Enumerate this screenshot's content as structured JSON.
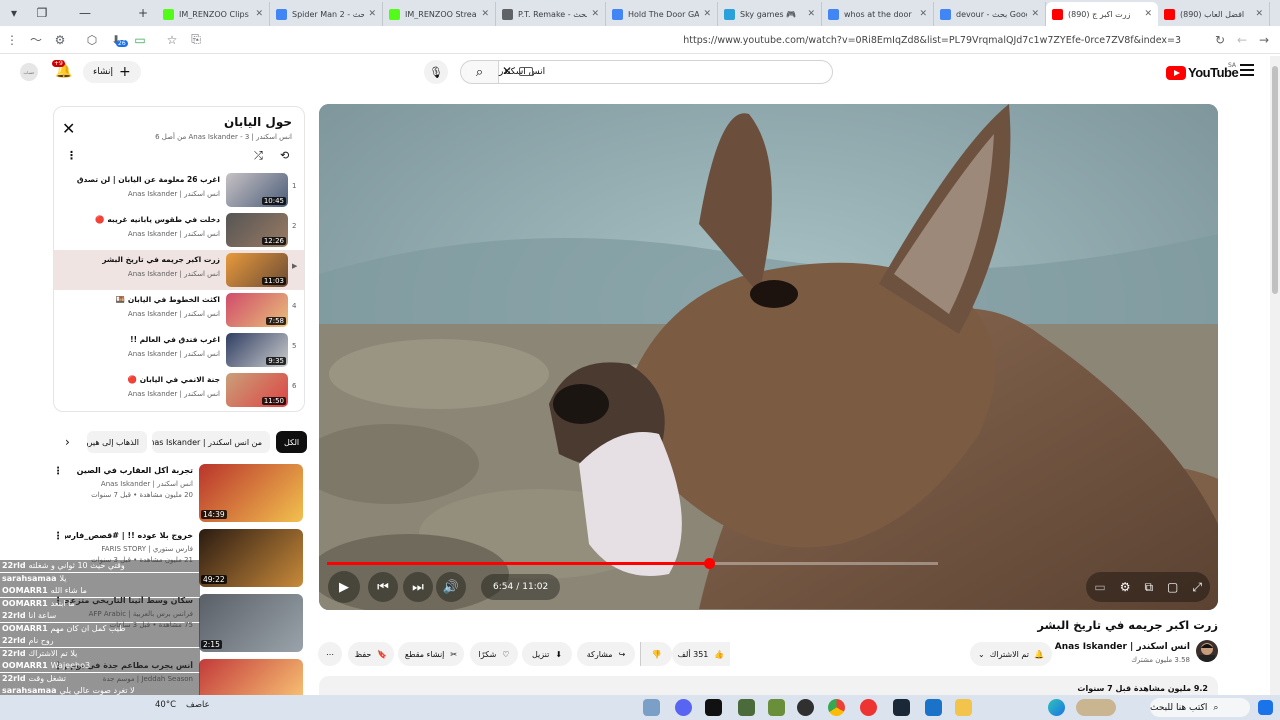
{
  "browser": {
    "tabs": [
      {
        "label": "IM_RENZOO Clips",
        "icon": "kick-icon",
        "color": "#53fc18"
      },
      {
        "label": "Spider Man 2 - بحث",
        "icon": "google-icon",
        "color": "#4285f4"
      },
      {
        "label": "IM_RENZOO Stream",
        "icon": "kick-icon",
        "color": "#53fc18"
      },
      {
        "label": "P.T. Remake - بحث",
        "icon": "globe-icon",
        "color": "#5f6368"
      },
      {
        "label": "Hold The Door GAM",
        "icon": "google-icon",
        "color": "#4285f4"
      },
      {
        "label": "Sky games 🎮",
        "icon": "telegram-icon",
        "color": "#2aa1da"
      },
      {
        "label": "whos at the door",
        "icon": "google-icon",
        "color": "#4285f4"
      },
      {
        "label": "devour - بحث Goog",
        "icon": "google-icon",
        "color": "#4285f4"
      },
      {
        "label": "(890) زرت اكبر ج",
        "icon": "youtube-icon",
        "color": "#ff0000",
        "active": true
      },
      {
        "label": "(890) افضل العاب",
        "icon": "youtube-icon",
        "color": "#ff0000"
      }
    ],
    "url": "https://www.youtube.com/watch?v=0Ri8EmIqZd8&list=PL79VrqmalQJd7c1w7ZYEfe-0rce7ZV8f&index=3",
    "downloads_badge": "26"
  },
  "masthead": {
    "logo_text": "YouTube",
    "region": "SA",
    "search_query": "انس اسكندر",
    "create_label": "إنشاء",
    "notif_count": "+9",
    "avatar_text": "حساب"
  },
  "player": {
    "current_time": "6:54",
    "duration": "11:02",
    "progress": 0.626,
    "scene_colors": {
      "sky": "#9fb9bd",
      "mountain": "#7f9ea3",
      "wall": "#8a8575",
      "deer": "#7a5a42"
    }
  },
  "video": {
    "title": "زرت اكبر جريمه في تاريخ البشر",
    "channel": "انس اسكندر | Anas Iskander",
    "subscribers": "3.58 مليون مشترك",
    "subscribed_label": "تم الاشتراك",
    "likes": "351 ألف",
    "share_label": "مشاركة",
    "download_label": "تنزيل",
    "thanks_label": "شكرًا",
    "clip_label": "إنشاء مقطع",
    "save_label": "حفظ",
    "views_line": "9.2 مليون مشاهدة  قبل 7 سنوات"
  },
  "playlist": {
    "title": "حول اليابان",
    "subtitle": "انس اسكندر | Anas Iskander - 3 من أصل 6",
    "items": [
      {
        "num": "1",
        "title": "اغرب 26 معلومة عن اليابان | لن تصدق",
        "channel": "انس اسكندر | Anas Iskander",
        "duration": "10:45"
      },
      {
        "num": "2",
        "title": "دخلت في طقوس يابانيه غريبه 🔴",
        "channel": "انس اسكندر | Anas Iskander",
        "duration": "12:26"
      },
      {
        "num": "▶",
        "title": "زرت اكبر جريمه في تاريخ البشر",
        "channel": "انس اسكندر | Anas Iskander",
        "duration": "11:03"
      },
      {
        "num": "4",
        "title": "اكثث الخطوط في اليابان 🍱",
        "channel": "انس اسكندر | Anas Iskander",
        "duration": "7:58"
      },
      {
        "num": "5",
        "title": "اغرب فندق في العالم !!",
        "channel": "انس اسكندر | Anas Iskander",
        "duration": "9:35"
      },
      {
        "num": "6",
        "title": "جنة الانمي في اليابان 🔴",
        "channel": "انس اسكندر | Anas Iskander",
        "duration": "11:50"
      }
    ]
  },
  "chips": {
    "all": "الكل",
    "from_channel": "من انس اسكندر | Anas Iskander",
    "next": "الذهاب إلى هيرو..."
  },
  "recommendations": [
    {
      "title": "تجربة أكل العقارب في الصين",
      "channel": "انس اسكندر | Anas Iskander",
      "meta": "20 مليون مشاهدة • قبل 7 سنوات",
      "duration": "14:39"
    },
    {
      "title": "خروج بلا عوده !! | #قصص_فارس",
      "channel": "فارس ستوري | FARIS STORY",
      "meta": "21 مليون مشاهدة • قبل 3 سنوات",
      "duration": "49:22"
    },
    {
      "title": "سكان وسط أثينا التاريخي متزعجون من السياحة المفرطة | AFP",
      "channel": "فرانس برس بالعربية | AFP Arabic",
      "meta": "75 مشاهدة • قبل 3 ساعات",
      "duration": "2:15"
    },
    {
      "title": "أنس يجرب مطاعم جدة في يوم واحد !! #موسم_جدة",
      "channel": "Jeddah Season | موسم جدة",
      "meta": "",
      "duration": ""
    }
  ],
  "chat": [
    {
      "user": "22rld",
      "text": "وقتي حيث 10 ثواني و شغلته"
    },
    {
      "user": "sarahsamaa",
      "text": "يلا"
    },
    {
      "user": "OOMARR1",
      "text": "ما شاء الله"
    },
    {
      "user": "OOMARR1",
      "text": "ما ابتعد"
    },
    {
      "user": "22rld",
      "text": "ساعة انا"
    },
    {
      "user": "OOMARR1",
      "text": "طيب كمل ان كان مهم"
    },
    {
      "user": "22rld",
      "text": "روح نام"
    },
    {
      "user": "22rld",
      "text": "يلا تم الاشتراك"
    },
    {
      "user": "OOMARR1",
      "text": "Wajeeho3"
    },
    {
      "user": "22rld",
      "text": "تشغل وقت"
    },
    {
      "user": "sarahsamaa",
      "text": "لا تغرد صوت عالي يلي"
    }
  ],
  "taskbar": {
    "temperature": "40°C",
    "weather": "عاصف",
    "search_placeholder": "اكتب هنا للبحث"
  }
}
